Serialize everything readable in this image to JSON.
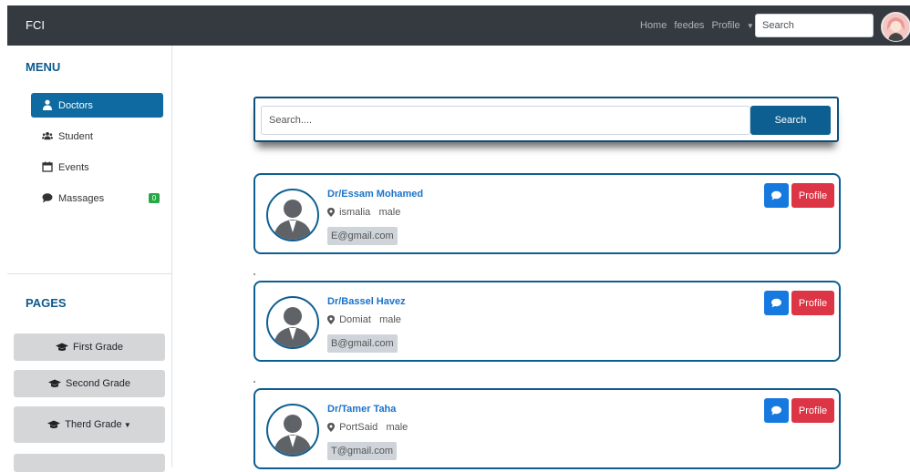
{
  "navbar": {
    "brand": "FCI",
    "links": [
      "Home",
      "feedes",
      "Profile"
    ],
    "search_placeholder": "Search",
    "avatar_icon": "user-avatar-icon"
  },
  "sidebar": {
    "menu_title": "MENU",
    "items": [
      {
        "label": "Doctors",
        "icon": "user-doctor-icon",
        "active": true
      },
      {
        "label": "Student",
        "icon": "users-icon",
        "active": false
      },
      {
        "label": "Events",
        "icon": "calendar-icon",
        "active": false
      },
      {
        "label": "Massages",
        "icon": "comment-icon",
        "active": false,
        "badge": "0"
      }
    ],
    "pages_title": "PAGES",
    "pages": [
      {
        "label": "First Grade",
        "icon": "graduation-cap-icon"
      },
      {
        "label": "Second Grade",
        "icon": "graduation-cap-icon"
      },
      {
        "label": "Therd Grade",
        "icon": "graduation-cap-icon",
        "dropdown": true
      }
    ]
  },
  "main": {
    "search": {
      "placeholder": "Search....",
      "button_label": "Search"
    },
    "doctors": [
      {
        "name": "Dr/Essam Mohamed",
        "city": "ismalia",
        "gender": "male",
        "email": "E@gmail.com",
        "profile_label": "Profile"
      },
      {
        "name": "Dr/Bassel Havez",
        "city": "Domiat",
        "gender": "male",
        "email": "B@gmail.com",
        "profile_label": "Profile"
      },
      {
        "name": "Dr/Tamer Taha",
        "city": "PortSaid",
        "gender": "male",
        "email": "T@gmail.com",
        "profile_label": "Profile"
      }
    ]
  },
  "colors": {
    "navbar": "#343a40",
    "primary_dark": "#0e5f91",
    "active_sidebar": "#0e6aa0",
    "danger": "#dc3545",
    "chat_blue": "#1679e0",
    "badge_green": "#28a745"
  }
}
